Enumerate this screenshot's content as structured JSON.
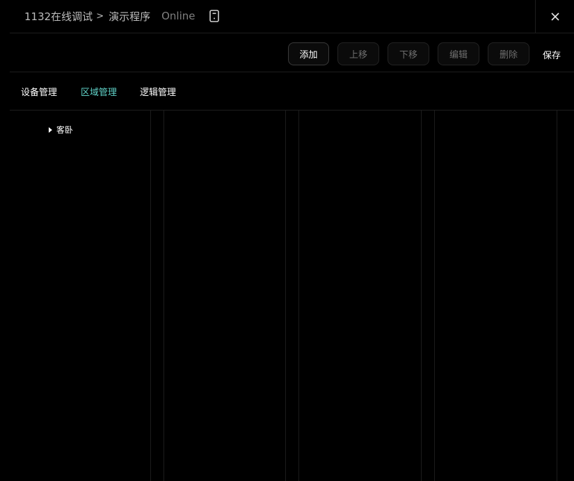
{
  "header": {
    "project": "1132在线调试",
    "separator": ">",
    "program": "演示程序",
    "status": "Online"
  },
  "toolbar": {
    "add_label": "添加",
    "up_label": "上移",
    "down_label": "下移",
    "edit_label": "编辑",
    "delete_label": "删除",
    "save_label": "保存"
  },
  "tabs": [
    {
      "label": "设备管理",
      "active": false
    },
    {
      "label": "区域管理",
      "active": true
    },
    {
      "label": "逻辑管理",
      "active": false
    }
  ],
  "tree": {
    "items": [
      {
        "label": "客卧",
        "expanded": false
      }
    ]
  },
  "colors": {
    "background": "#000000",
    "accent": "#5fd0c6",
    "text_primary": "#ffffff",
    "text_muted": "#7f7f7f",
    "border": "#1e1e1e"
  },
  "icons": {
    "device": "tablet-icon",
    "close": "close-icon",
    "caret": "caret-right-icon"
  }
}
